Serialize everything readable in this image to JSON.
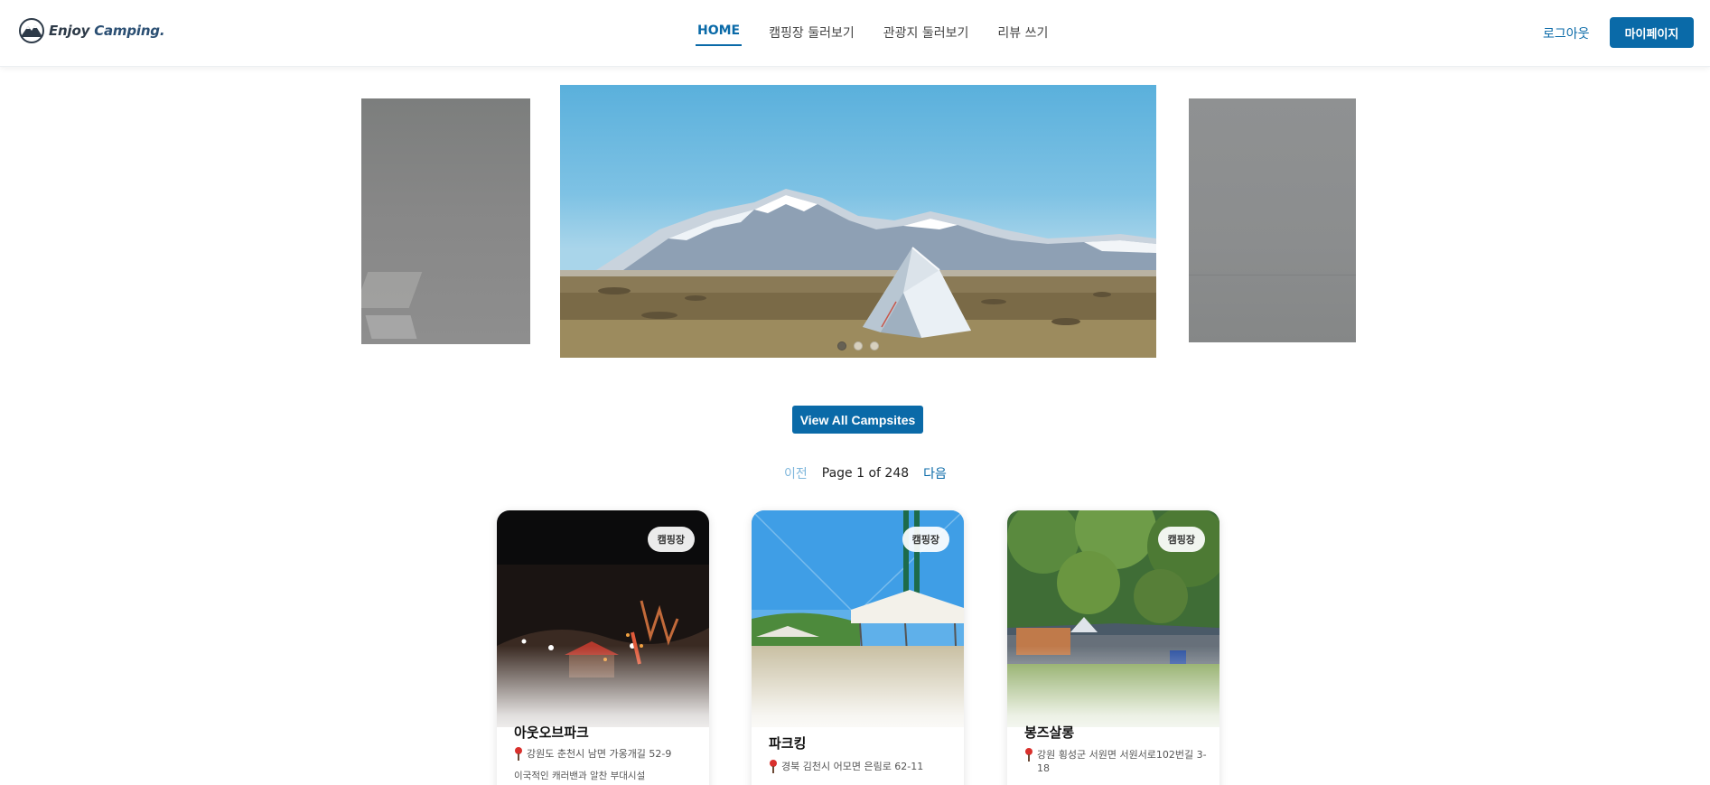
{
  "header": {
    "logo_text_1": "Enjoy",
    "logo_text_2": "Camping.",
    "nav": [
      "HOME",
      "캠핑장 둘러보기",
      "관광지 둘러보기",
      "리뷰 쓰기"
    ],
    "active_nav": "HOME",
    "logout": "로그아웃",
    "mypage": "마이페이지",
    "accent_color": "#0a6aa8"
  },
  "carousel": {
    "slide_count": 3,
    "active_index": 0
  },
  "view_all_label": "View All Campsites",
  "pagination": {
    "prev": "이전",
    "info": "Page 1 of 248",
    "next": "다음"
  },
  "cards": [
    {
      "badge": "캠핑장",
      "title": "아웃오브파크",
      "address": "강원도 춘천시 남면 가옹개길 52-9",
      "description": "이국적인 캐러밴과 알찬 부대시설"
    },
    {
      "badge": "캠핑장",
      "title": "파크킹",
      "address": "경북 김천시 어모면 은림로 62-11",
      "description": ""
    },
    {
      "badge": "캠핑장",
      "title": "봉즈살롱",
      "address": "강원 횡성군 서원면 서원서로102번길 3-18",
      "description": ""
    }
  ]
}
